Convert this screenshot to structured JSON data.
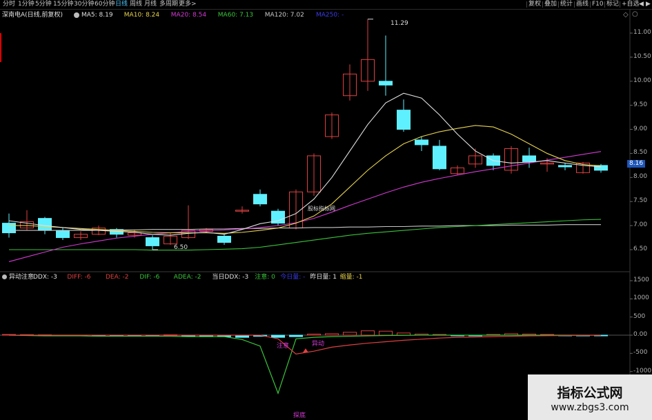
{
  "toolbar": {
    "periods": [
      "分时",
      "1分钟",
      "5分钟",
      "15分钟",
      "30分钟",
      "60分钟",
      "日线",
      "周线",
      "月线",
      "多周期",
      "更多>"
    ],
    "active_period": "日线",
    "right_buttons": [
      "复权",
      "叠加",
      "统计",
      "画线",
      "F10",
      "标记",
      "+自选"
    ],
    "nav_icons": [
      "arrow-left-icon",
      "arrow-right-icon"
    ]
  },
  "main_panel": {
    "stock_title": "深南电A(日线,前复权)",
    "ma_legend": [
      {
        "label": "MA5: 8.19",
        "color": "#e0e0e0"
      },
      {
        "label": "MA10: 8.24",
        "color": "#e8d34c"
      },
      {
        "label": "MA20: 8.54",
        "color": "#d43ad4"
      },
      {
        "label": "MA60: 7.13",
        "color": "#3ac43a"
      },
      {
        "label": "MA120: 7.02",
        "color": "#c8c8c8"
      },
      {
        "label": "MA250: -",
        "color": "#3a3ae8"
      }
    ],
    "high_label": "11.29",
    "low_label": "6.50",
    "current_price": "8.16",
    "inline_watermark": "股标指标网",
    "y_ticks": [
      "11.00",
      "10.50",
      "10.00",
      "9.50",
      "9.00",
      "8.50",
      "8.00",
      "7.50",
      "7.00",
      "6.50"
    ]
  },
  "indicator_panel": {
    "title": "异动注意",
    "legend": [
      {
        "label": "DDX: -3",
        "color": "#e0e0e0"
      },
      {
        "label": "DIFF: -6",
        "color": "#e04040"
      },
      {
        "label": "DEA: -2",
        "color": "#e04040"
      },
      {
        "label": "DIF: -6",
        "color": "#3ac43a"
      },
      {
        "label": "ADEA: -2",
        "color": "#3ac43a"
      },
      {
        "label": "当日DDX: -3",
        "color": "#e0e0e0"
      },
      {
        "label": "注意: 0",
        "color": "#3ac43a"
      },
      {
        "label": "今日量: -",
        "color": "#3a3ae8"
      },
      {
        "label": "昨日量: 1",
        "color": "#e0e0e0"
      },
      {
        "label": "缩量: -1",
        "color": "#e8d34c"
      }
    ],
    "annotations": [
      "注意",
      "异动",
      "探底"
    ],
    "y_ticks": [
      "1500",
      "1000",
      "500",
      "0.00",
      "-500",
      "-1000",
      "-1500"
    ]
  },
  "watermark": {
    "line1": "指标公式网",
    "line2": "www.zbgs3.com"
  },
  "colors": {
    "up": "#e04040",
    "down": "#5ff0ff",
    "ma5": "#e0e0e0",
    "ma10": "#e8d34c",
    "ma20": "#d43ad4",
    "ma60": "#3ac43a",
    "ma120": "#c8c8c8",
    "accent": "#4fc3f7"
  },
  "chart_data": {
    "type": "candlestick",
    "x_count": 36,
    "price_range": [
      6.3,
      11.5
    ],
    "candles": [
      {
        "o": 7.05,
        "c": 6.85,
        "h": 7.25,
        "l": 6.75
      },
      {
        "o": 6.95,
        "c": 7.08,
        "h": 7.32,
        "l": 6.9
      },
      {
        "o": 7.15,
        "c": 6.9,
        "h": 7.18,
        "l": 6.82
      },
      {
        "o": 6.9,
        "c": 6.75,
        "h": 6.95,
        "l": 6.7
      },
      {
        "o": 6.75,
        "c": 6.82,
        "h": 6.88,
        "l": 6.7
      },
      {
        "o": 6.82,
        "c": 6.95,
        "h": 7.0,
        "l": 6.8
      },
      {
        "o": 6.92,
        "c": 6.82,
        "h": 6.95,
        "l": 6.75
      },
      {
        "o": 6.8,
        "c": 6.85,
        "h": 6.92,
        "l": 6.75
      },
      {
        "o": 6.75,
        "c": 6.58,
        "h": 6.8,
        "l": 6.5
      },
      {
        "o": 6.62,
        "c": 6.78,
        "h": 6.85,
        "l": 6.6
      },
      {
        "o": 6.75,
        "c": 6.9,
        "h": 7.42,
        "l": 6.72
      },
      {
        "o": 6.88,
        "c": 6.92,
        "h": 6.95,
        "l": 6.85
      },
      {
        "o": 6.78,
        "c": 6.65,
        "h": 6.82,
        "l": 6.6
      },
      {
        "o": 7.3,
        "c": 7.32,
        "h": 7.4,
        "l": 7.25
      },
      {
        "o": 7.65,
        "c": 7.45,
        "h": 7.75,
        "l": 7.4
      },
      {
        "o": 7.3,
        "c": 7.05,
        "h": 7.35,
        "l": 7.0
      },
      {
        "o": 6.95,
        "c": 7.7,
        "h": 7.75,
        "l": 6.92
      },
      {
        "o": 7.7,
        "c": 8.45,
        "h": 8.5,
        "l": 7.62
      },
      {
        "o": 8.85,
        "c": 9.3,
        "h": 9.35,
        "l": 8.8
      },
      {
        "o": 9.7,
        "c": 10.15,
        "h": 10.35,
        "l": 9.6
      },
      {
        "o": 10.0,
        "c": 10.45,
        "h": 11.29,
        "l": 9.8
      },
      {
        "o": 10.0,
        "c": 9.92,
        "h": 10.95,
        "l": 9.7
      },
      {
        "o": 9.4,
        "c": 9.0,
        "h": 9.62,
        "l": 8.95
      },
      {
        "o": 8.78,
        "c": 8.68,
        "h": 8.85,
        "l": 8.55
      },
      {
        "o": 8.65,
        "c": 8.18,
        "h": 8.78,
        "l": 8.15
      },
      {
        "o": 8.08,
        "c": 8.2,
        "h": 8.25,
        "l": 8.05
      },
      {
        "o": 8.28,
        "c": 8.45,
        "h": 8.6,
        "l": 8.2
      },
      {
        "o": 8.45,
        "c": 8.25,
        "h": 8.5,
        "l": 8.15
      },
      {
        "o": 8.15,
        "c": 8.6,
        "h": 8.65,
        "l": 8.08
      },
      {
        "o": 8.45,
        "c": 8.33,
        "h": 8.62,
        "l": 8.2
      },
      {
        "o": 8.28,
        "c": 8.3,
        "h": 8.4,
        "l": 8.12
      },
      {
        "o": 8.25,
        "c": 8.22,
        "h": 8.3,
        "l": 8.15
      },
      {
        "o": 8.1,
        "c": 8.3,
        "h": 8.32,
        "l": 8.08
      },
      {
        "o": 8.25,
        "c": 8.15,
        "h": 8.28,
        "l": 8.1
      }
    ],
    "ma5": [
      7.1,
      7.05,
      7.0,
      6.96,
      6.92,
      6.9,
      6.88,
      6.86,
      6.82,
      6.8,
      6.84,
      6.86,
      6.82,
      6.92,
      7.04,
      7.1,
      7.25,
      7.55,
      8.0,
      8.55,
      9.1,
      9.55,
      9.75,
      9.65,
      9.3,
      8.9,
      8.55,
      8.35,
      8.3,
      8.32,
      8.35,
      8.3,
      8.25,
      8.22
    ],
    "ma10": [
      7.0,
      7.0,
      6.98,
      6.96,
      6.94,
      6.92,
      6.9,
      6.88,
      6.86,
      6.85,
      6.85,
      6.85,
      6.84,
      6.86,
      6.9,
      6.95,
      7.05,
      7.2,
      7.45,
      7.8,
      8.15,
      8.45,
      8.7,
      8.85,
      8.95,
      9.02,
      9.08,
      9.05,
      8.9,
      8.7,
      8.5,
      8.35,
      8.27,
      8.24
    ],
    "ma20": [
      6.25,
      6.35,
      6.45,
      6.55,
      6.62,
      6.68,
      6.74,
      6.78,
      6.82,
      6.85,
      6.88,
      6.9,
      6.91,
      6.93,
      6.96,
      7.0,
      7.06,
      7.15,
      7.28,
      7.42,
      7.55,
      7.68,
      7.8,
      7.9,
      7.98,
      8.05,
      8.12,
      8.18,
      8.24,
      8.3,
      8.36,
      8.42,
      8.48,
      8.54
    ],
    "ma60": [
      6.5,
      6.5,
      6.5,
      6.5,
      6.5,
      6.5,
      6.5,
      6.5,
      6.49,
      6.49,
      6.49,
      6.5,
      6.51,
      6.52,
      6.55,
      6.6,
      6.65,
      6.7,
      6.75,
      6.8,
      6.84,
      6.87,
      6.9,
      6.93,
      6.96,
      6.98,
      7.0,
      7.02,
      7.04,
      7.06,
      7.08,
      7.1,
      7.12,
      7.13
    ],
    "ma120": [
      6.9,
      6.9,
      6.9,
      6.9,
      6.9,
      6.9,
      6.91,
      6.91,
      6.92,
      6.92,
      6.92,
      6.93,
      6.93,
      6.94,
      6.94,
      6.95,
      6.95,
      6.96,
      6.96,
      6.97,
      6.97,
      6.98,
      6.98,
      6.99,
      6.99,
      7.0,
      7.0,
      7.0,
      7.01,
      7.01,
      7.01,
      7.02,
      7.02,
      7.02
    ],
    "indicator": {
      "range": [
        -1700,
        1700
      ],
      "bars": [
        20,
        15,
        10,
        -10,
        -15,
        -20,
        -15,
        -10,
        -5,
        10,
        -10,
        -20,
        -40,
        -60,
        -30,
        -60,
        -40,
        30,
        40,
        80,
        120,
        110,
        60,
        30,
        20,
        -10,
        -10,
        20,
        40,
        30,
        20,
        -10,
        -20,
        -10
      ],
      "red_line": [
        0,
        0,
        0,
        0,
        0,
        0,
        0,
        0,
        0,
        0,
        0,
        0,
        0,
        0,
        0,
        -100,
        -520,
        -440,
        -330,
        -270,
        -220,
        -180,
        -140,
        -110,
        -80,
        -60,
        -50,
        -40,
        -30,
        -20,
        -15,
        -10,
        -5,
        0
      ],
      "green_line": [
        0,
        -10,
        -20,
        -20,
        -20,
        -30,
        -30,
        -30,
        -30,
        -30,
        -40,
        -40,
        -40,
        -120,
        -300,
        -1600,
        -100,
        -60,
        -40,
        -30,
        -20,
        -10,
        -5,
        0,
        0,
        0,
        0,
        0,
        0,
        0,
        0,
        0,
        0,
        0
      ]
    }
  }
}
